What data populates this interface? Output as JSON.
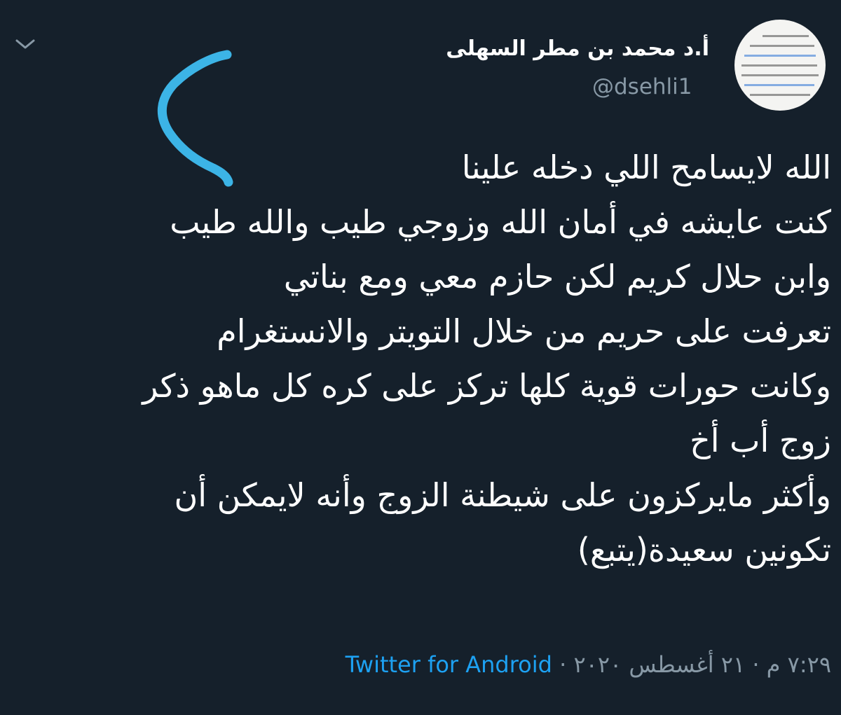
{
  "author": {
    "display_name": "أ.د محمد بن مطر السهلى",
    "handle": "@dsehli1"
  },
  "tweet": {
    "lines": [
      "الله لايسامح اللي دخله علينا",
      "كنت عايشه في أمان الله وزوجي طيب والله طيب",
      "وابن حلال كريم لكن حازم معي ومع بناتي",
      "تعرفت على حريم من خلال التويتر والانستغرام",
      "وكانت حورات قوية كلها تركز على كره كل ماهو ذكر",
      "زوج أب أخ",
      "وأكثر مايركزون على شيطنة الزوج وأنه لايمكن أن",
      "تكونين سعيدة(يتبع)"
    ]
  },
  "meta": {
    "time": "٧:٢٩ م",
    "separator": "·",
    "date": "٢١ أغسطس ٢٠٢٠",
    "source": "Twitter for Android"
  },
  "icons": {
    "menu": "chevron-down-icon",
    "annotation": "hand-drawn-bracket"
  },
  "colors": {
    "background": "#15202b",
    "text": "#ffffff",
    "muted": "#8899a6",
    "link": "#1da1f2",
    "annotation": "#3cb4e6"
  }
}
